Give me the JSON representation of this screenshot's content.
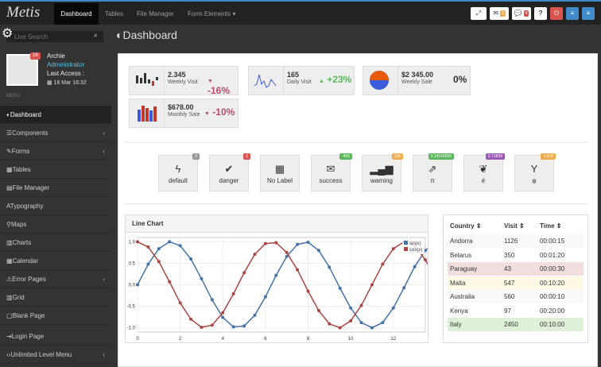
{
  "topbar": {
    "brand": "Metis",
    "nav": [
      "Dashboard",
      "Tables",
      "File Manager",
      "Form Elements"
    ],
    "mail_badge": "3",
    "comments_badge": "4",
    "help": "?",
    "colors": {
      "accent": "#428bca",
      "danger": "#d9534f",
      "warning": "#f0ad4e"
    }
  },
  "sidebar": {
    "search_placeholder": "Live Search",
    "user": {
      "name": "Archie",
      "role": "Administrator",
      "last_access_label": "Last Access :",
      "date": "16 Mar 16:32",
      "badge": "16"
    },
    "menu_header": "MENU",
    "items": [
      {
        "label": "Dashboard",
        "icon": "dashboard-icon"
      },
      {
        "label": "Components",
        "icon": "list-icon"
      },
      {
        "label": "Forms",
        "icon": "pencil-icon"
      },
      {
        "label": "Tables",
        "icon": "table-icon"
      },
      {
        "label": "File Manager",
        "icon": "file-icon"
      },
      {
        "label": "Typography",
        "icon": "font-icon"
      },
      {
        "label": "Maps",
        "icon": "map-marker-icon"
      },
      {
        "label": "Charts",
        "icon": "bar-chart-icon"
      },
      {
        "label": "Calendar",
        "icon": "calendar-icon"
      },
      {
        "label": "Error Pages",
        "icon": "warning-icon"
      },
      {
        "label": "Grid",
        "icon": "columns-icon"
      },
      {
        "label": "Blank Page",
        "icon": "square-icon"
      },
      {
        "label": "Login Page",
        "icon": "login-icon"
      },
      {
        "label": "Unlimited Level Menu",
        "icon": "code-icon"
      }
    ]
  },
  "page": {
    "title": "Dashboard"
  },
  "stats": [
    {
      "value": "2.345",
      "label": "Weekly Visit",
      "change": "-16%"
    },
    {
      "value": "165",
      "label": "Daily Visit",
      "change": "+23%"
    },
    {
      "value": "$2 345.00",
      "label": "Weekly Sale",
      "change": "0%"
    },
    {
      "value": "$678.00",
      "label": "Monthly Sale",
      "change": "-10%"
    }
  ],
  "quick_buttons": [
    {
      "label": "default",
      "badge": "2",
      "icon": "bolt-icon"
    },
    {
      "label": "danger",
      "badge": "2",
      "icon": "check-icon"
    },
    {
      "label": "No Label",
      "badge": "",
      "icon": "building-icon"
    },
    {
      "label": "success",
      "badge": "-456",
      "icon": "envelope-icon"
    },
    {
      "label": "warning",
      "badge": "+25",
      "icon": "signal-icon"
    },
    {
      "label": "π",
      "badge": "3.14159265",
      "icon": "external-link-icon"
    },
    {
      "label": "é",
      "badge": "2.71828",
      "icon": "leaf-icon"
    },
    {
      "label": "φ",
      "badge": "1.618",
      "icon": "glass-icon"
    }
  ],
  "line_chart": {
    "title": "Line Chart",
    "chart_data": {
      "type": "line",
      "x": [
        0,
        0.5,
        1,
        1.5,
        2,
        2.5,
        3,
        3.5,
        4,
        4.5,
        5,
        5.5,
        6,
        6.5,
        7,
        7.5,
        8,
        8.5,
        9,
        9.5,
        10,
        10.5,
        11,
        11.5,
        12,
        12.5,
        13,
        13.5,
        14
      ],
      "series": [
        {
          "name": "sin(x)",
          "values": [
            0,
            0.48,
            0.84,
            1,
            0.91,
            0.6,
            0.14,
            -0.35,
            -0.76,
            -0.98,
            -0.96,
            -0.71,
            -0.28,
            0.22,
            0.66,
            0.94,
            0.99,
            0.8,
            0.41,
            -0.08,
            -0.54,
            -0.88,
            -1,
            -0.88,
            -0.54,
            -0.07,
            0.42,
            0.8,
            0.99
          ],
          "color": "#4572a7"
        },
        {
          "name": "cos(x)",
          "values": [
            1,
            0.88,
            0.54,
            0.07,
            -0.42,
            -0.8,
            -0.99,
            -0.94,
            -0.65,
            -0.21,
            0.28,
            0.71,
            0.96,
            0.98,
            0.75,
            0.35,
            -0.15,
            -0.6,
            -0.91,
            -1,
            -0.84,
            -0.48,
            0,
            0.48,
            0.84,
            1,
            0.91,
            0.58,
            0.14
          ],
          "color": "#aa4643"
        }
      ],
      "xlim": [
        0,
        13.5
      ],
      "ylim": [
        -1.1,
        1.1
      ],
      "xticks": [
        "0",
        "2",
        "4",
        "6",
        "8",
        "10",
        "12"
      ],
      "yticks": [
        "1.0",
        "0.5",
        "0.0",
        "-0.5",
        "-1.0"
      ],
      "grid": true,
      "legend": "top-right"
    }
  },
  "table": {
    "headers": [
      "Country",
      "Visit",
      "Time"
    ],
    "rows": [
      {
        "country": "Andorra",
        "visit": "1126",
        "time": "00:00:15",
        "status": "",
        "bg": "#f9f9f9"
      },
      {
        "country": "Belarus",
        "visit": "350",
        "time": "00:01:20",
        "status": "",
        "bg": "#ffffff"
      },
      {
        "country": "Paraguay",
        "visit": "43",
        "time": "00:00:30",
        "status": "danger",
        "bg": "#f2dede"
      },
      {
        "country": "Malta",
        "visit": "547",
        "time": "00:10:20",
        "status": "warning",
        "bg": "#fcf8e3"
      },
      {
        "country": "Australia",
        "visit": "560",
        "time": "00:00:10",
        "status": "",
        "bg": "#f9f9f9"
      },
      {
        "country": "Kenya",
        "visit": "97",
        "time": "00:20:00",
        "status": "",
        "bg": "#ffffff"
      },
      {
        "country": "Italy",
        "visit": "2450",
        "time": "00:10:00",
        "status": "success",
        "bg": "#dff0d8"
      }
    ]
  }
}
